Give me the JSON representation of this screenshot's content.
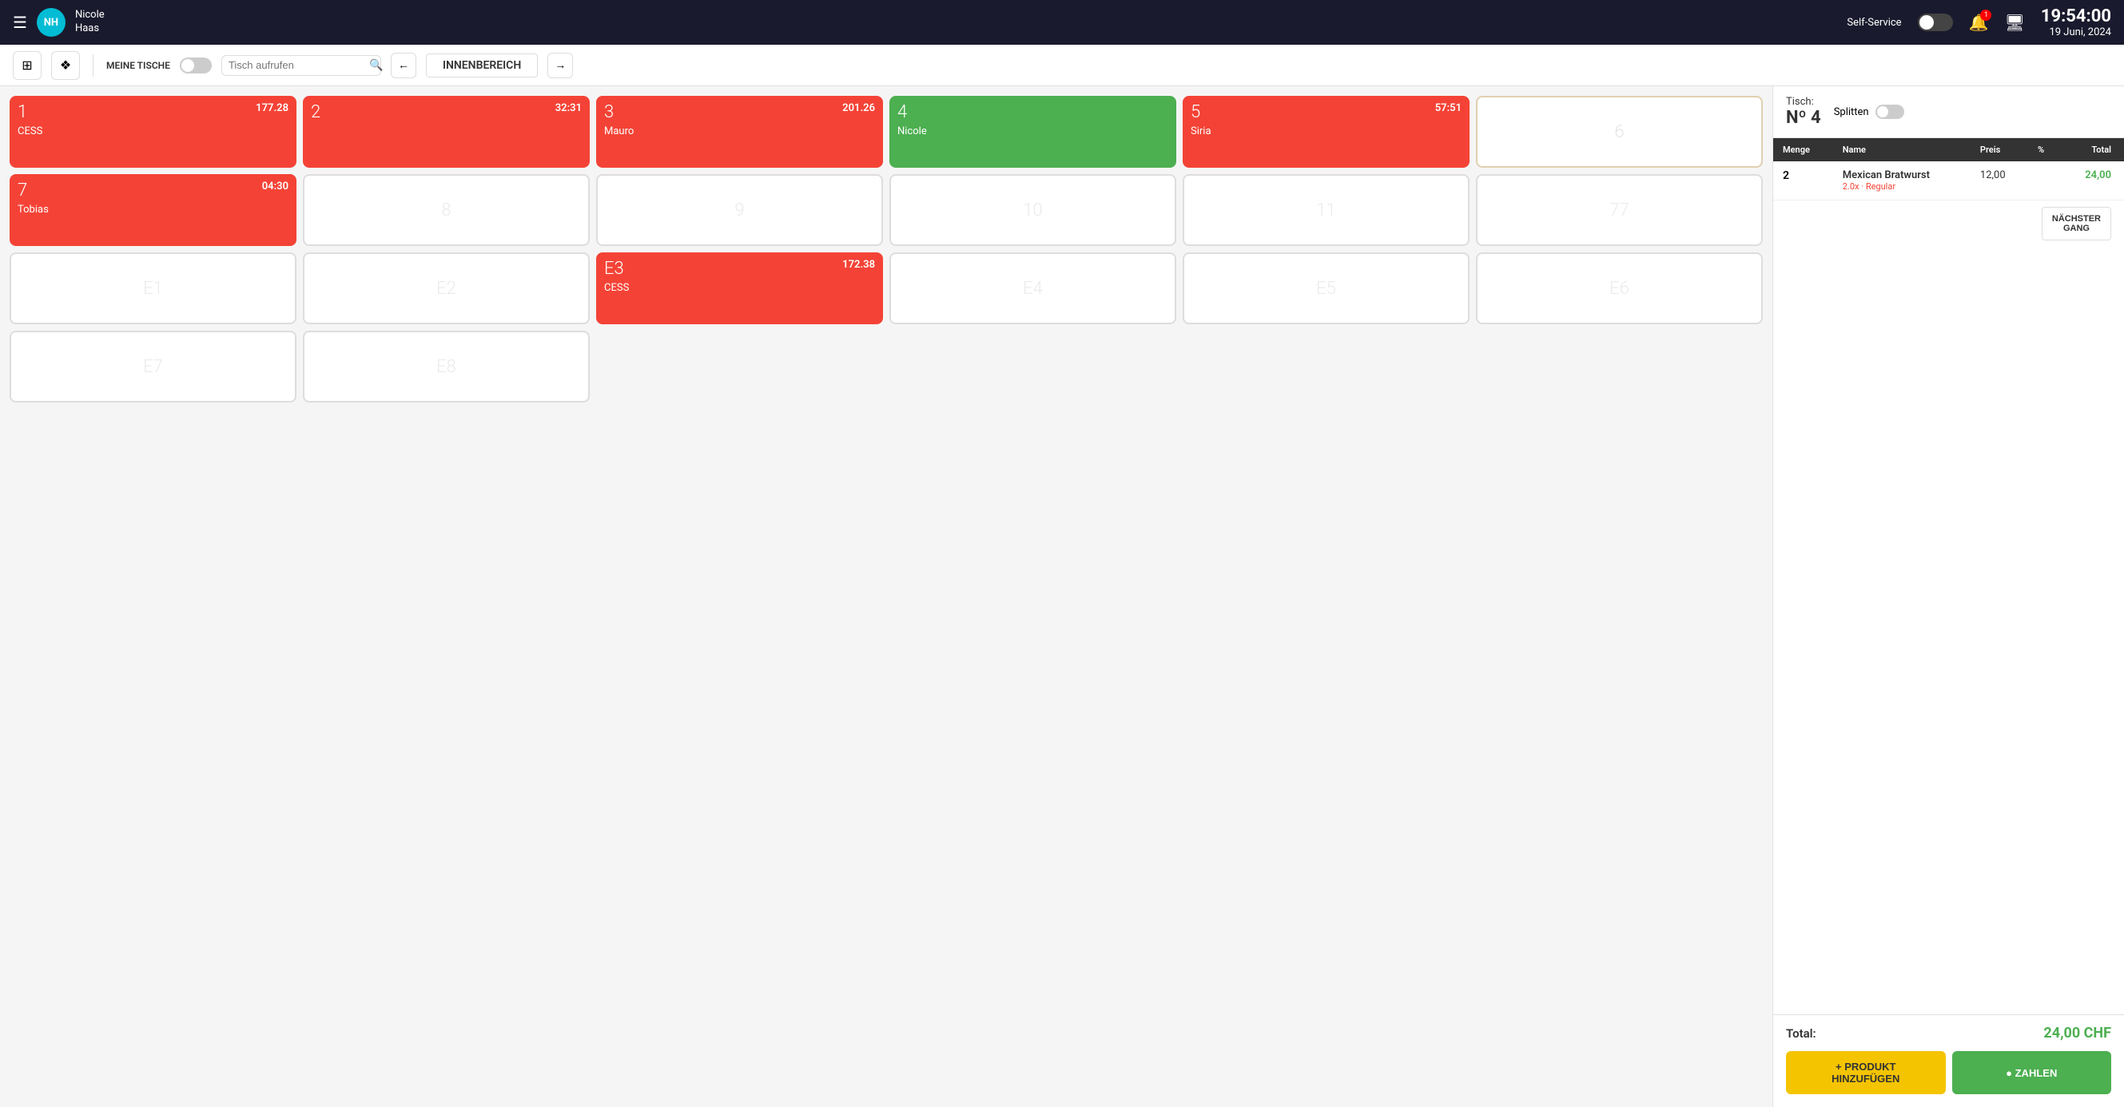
{
  "topbar": {
    "hamburger": "☰",
    "avatar_initials": "NH",
    "user_name": "Nicole\nHaas",
    "self_service_label": "Self-Service",
    "bell_badge": "1",
    "clock_time": "19:54:00",
    "clock_date": "19 Juni, 2024"
  },
  "toolbar": {
    "meine_tische_label": "MEINE TISCHE",
    "search_placeholder": "Tisch aufrufen",
    "zone_label": "INNENBEREICH"
  },
  "tables": [
    {
      "id": "1",
      "number": "1",
      "amount": "177.28",
      "name": "CESS",
      "type": "red"
    },
    {
      "id": "2",
      "number": "2",
      "amount": "32:31",
      "name": "",
      "type": "red"
    },
    {
      "id": "3",
      "number": "3",
      "amount": "201.26",
      "name": "Mauro",
      "type": "red"
    },
    {
      "id": "4",
      "number": "4",
      "amount": "",
      "name": "Nicole",
      "type": "green"
    },
    {
      "id": "5",
      "number": "5",
      "amount": "57:51",
      "name": "Siria",
      "type": "red"
    },
    {
      "id": "6",
      "number": "6",
      "amount": "",
      "name": "",
      "type": "empty"
    },
    {
      "id": "7",
      "number": "7",
      "amount": "04:30",
      "name": "Tobias",
      "type": "red"
    },
    {
      "id": "8",
      "number": "8",
      "amount": "",
      "name": "",
      "type": "empty-thin"
    },
    {
      "id": "9",
      "number": "9",
      "amount": "",
      "name": "",
      "type": "empty-thin"
    },
    {
      "id": "10",
      "number": "10",
      "amount": "",
      "name": "",
      "type": "empty-thin"
    },
    {
      "id": "11",
      "number": "11",
      "amount": "",
      "name": "",
      "type": "empty-thin"
    },
    {
      "id": "77",
      "number": "77",
      "amount": "",
      "name": "",
      "type": "empty-thin"
    },
    {
      "id": "E1",
      "number": "",
      "placeholder": "E1",
      "amount": "",
      "name": "",
      "type": "empty-thin"
    },
    {
      "id": "E2",
      "number": "",
      "placeholder": "E2",
      "amount": "",
      "name": "",
      "type": "empty-thin"
    },
    {
      "id": "E3",
      "number": "E3",
      "amount": "172.38",
      "name": "CESS",
      "type": "red"
    },
    {
      "id": "E4",
      "number": "",
      "placeholder": "E4",
      "amount": "",
      "name": "",
      "type": "empty-thin"
    },
    {
      "id": "E5",
      "number": "",
      "placeholder": "E5",
      "amount": "",
      "name": "",
      "type": "empty-thin"
    },
    {
      "id": "E6",
      "number": "",
      "placeholder": "E6",
      "amount": "",
      "name": "",
      "type": "empty-thin"
    },
    {
      "id": "E7",
      "number": "",
      "placeholder": "E7",
      "amount": "",
      "name": "",
      "type": "empty-thin"
    },
    {
      "id": "E8",
      "number": "",
      "placeholder": "E8",
      "amount": "",
      "name": "",
      "type": "empty-thin"
    }
  ],
  "right_panel": {
    "tisch_label": "Tisch:",
    "table_number": "Nº 4",
    "splitten_label": "Splitten",
    "columns": [
      "Menge",
      "Name",
      "Preis",
      "%",
      "Total"
    ],
    "order_items": [
      {
        "qty": "2",
        "name": "Mexican Bratwurst",
        "sub": "2.0x · Regular",
        "preis": "12,00",
        "percent": "",
        "total": "24,00"
      }
    ],
    "next_gang_label": "NÄCHSTER\nGANG",
    "total_label": "Total:",
    "total_value": "24,00 CHF",
    "add_product_label": "+ PRODUKT\nHINZUFÜGEN",
    "pay_label": "● ZAHLEN"
  }
}
